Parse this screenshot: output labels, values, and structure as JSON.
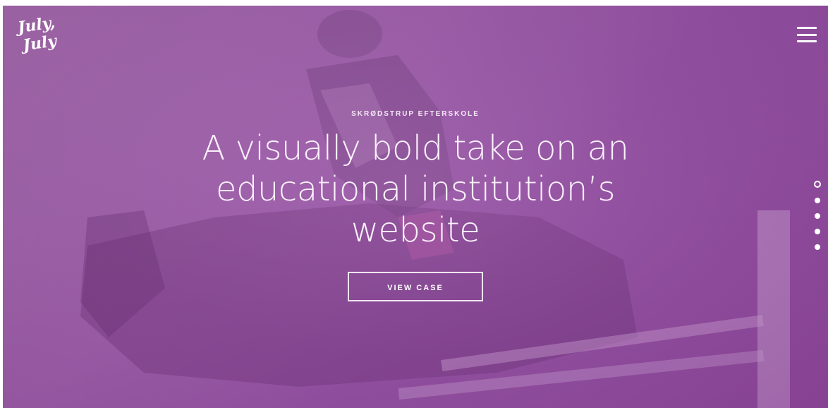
{
  "brand": {
    "logo_line1": "July,",
    "logo_line2": "July"
  },
  "hero": {
    "eyebrow": "SKRØDSTRUP EFTERSKOLE",
    "headline": "A visually bold take on an educational institution’s website",
    "cta_label": "VIEW CASE"
  },
  "navigation": {
    "menu_icon": "hamburger-icon",
    "slides_total": 5,
    "active_slide": 1
  },
  "colors": {
    "overlay": "#9a5ea6",
    "text": "#ffffff"
  }
}
